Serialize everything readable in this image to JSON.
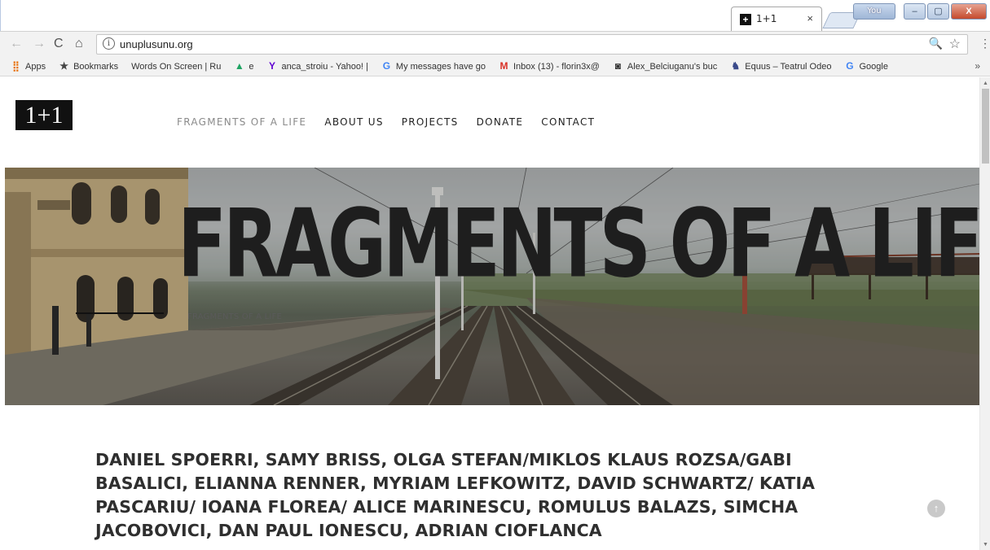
{
  "browser": {
    "tab_title": "1+1",
    "tab_favicon": "+",
    "tab_close": "×",
    "user_badge": "You",
    "window_buttons": {
      "minimize": "–",
      "maximize": "▢",
      "close": "X"
    },
    "url": "unuplusunu.org",
    "nav": {
      "back": "←",
      "forward": "→",
      "reload": "C",
      "home": "⌂"
    },
    "info_icon": "i",
    "zoom_icon": "🔍",
    "star_icon": "☆",
    "menu_icon": "⋮"
  },
  "bookmarks": {
    "items": [
      {
        "label": "Apps",
        "icon": "apps-grid-icon",
        "glyph": "⣿",
        "color": "#e8710a"
      },
      {
        "label": "Bookmarks",
        "icon": "star-icon",
        "glyph": "★",
        "color": "#444444"
      },
      {
        "label": "Words On Screen | Ru",
        "icon": "",
        "glyph": "",
        "color": ""
      },
      {
        "label": "e",
        "icon": "google-drive-icon",
        "glyph": "▲",
        "color": "#1fa463"
      },
      {
        "label": "anca_stroiu - Yahoo! |",
        "icon": "yahoo-icon",
        "glyph": "Y",
        "color": "#5f01d1"
      },
      {
        "label": "My messages have go",
        "icon": "google-icon",
        "glyph": "G",
        "color": "#4285f4"
      },
      {
        "label": "Inbox (13) - florin3x@",
        "icon": "gmail-icon",
        "glyph": "M",
        "color": "#d93025"
      },
      {
        "label": "Alex_Belciuganu's buc",
        "icon": "instagram-icon",
        "glyph": "◙",
        "color": "#333333"
      },
      {
        "label": "Equus – Teatrul Odeo",
        "icon": "horse-icon",
        "glyph": "♞",
        "color": "#3a4a8a"
      },
      {
        "label": "Google",
        "icon": "google-icon",
        "glyph": "G",
        "color": "#4285f4"
      }
    ],
    "more": "»"
  },
  "site": {
    "logo": "1+1",
    "nav": [
      {
        "label": "FRAGMENTS OF A LIFE",
        "active": true
      },
      {
        "label": "ABOUT US",
        "active": false
      },
      {
        "label": "PROJECTS",
        "active": false
      },
      {
        "label": "DONATE",
        "active": false
      },
      {
        "label": "CONTACT",
        "active": false
      }
    ],
    "hero_title": "FRAGMENTS OF A LIFE",
    "hero_subtitle": "FRAGMENTS OF A LIFE",
    "credits": "DANIEL SPOERRI, SAMY BRISS, OLGA STEFAN/MIKLOS KLAUS ROZSA/GABI BASALICI, ELIANNA RENNER, MYRIAM LEFKOWITZ, DAVID SCHWARTZ/ KATIA PASCARIU/ IOANA FLOREA/ ALICE MARINESCU, ROMULUS BALAZS, SIMCHA JACOBOVICI, DAN PAUL IONESCU, ADRIAN CIOFLANCA",
    "back_to_top": "↑"
  }
}
